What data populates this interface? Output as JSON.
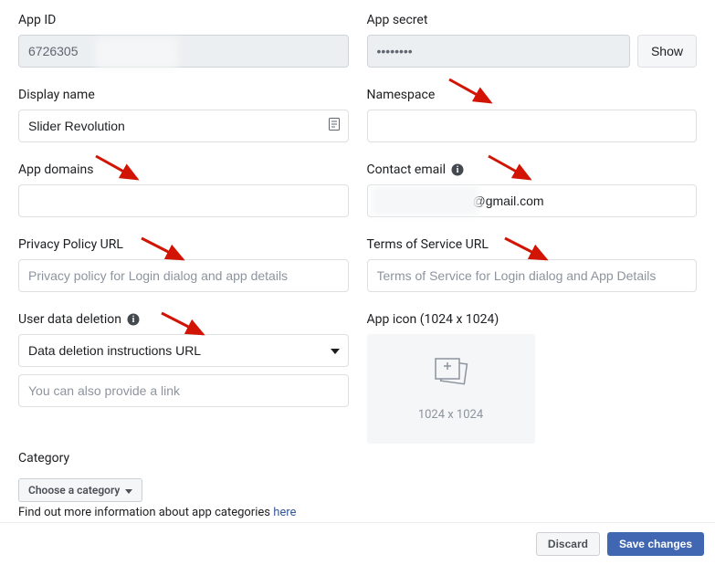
{
  "left": {
    "app_id": {
      "label": "App ID",
      "value": "6726305"
    },
    "display_name": {
      "label": "Display name",
      "value": "Slider Revolution"
    },
    "app_domains": {
      "label": "App domains",
      "value": ""
    },
    "privacy_url": {
      "label": "Privacy Policy URL",
      "placeholder": "Privacy policy for Login dialog and app details",
      "value": ""
    },
    "user_data_deletion": {
      "label": "User data deletion",
      "selected": "Data deletion instructions URL",
      "link_placeholder": "You can also provide a link",
      "link_value": ""
    }
  },
  "right": {
    "app_secret": {
      "label": "App secret",
      "value": "••••••••",
      "show_label": "Show"
    },
    "namespace": {
      "label": "Namespace",
      "value": ""
    },
    "contact_email": {
      "label": "Contact email",
      "value": "                           @gmail.com"
    },
    "tos_url": {
      "label": "Terms of Service URL",
      "placeholder": "Terms of Service for Login dialog and App Details",
      "value": ""
    },
    "app_icon": {
      "label": "App icon (1024 x 1024)",
      "dims": "1024 x 1024"
    }
  },
  "category": {
    "label": "Category",
    "select_placeholder": "Choose a category",
    "info_text": "Find out more information about app categories ",
    "info_link": "here"
  },
  "footer": {
    "discard": "Discard",
    "save": "Save changes"
  }
}
